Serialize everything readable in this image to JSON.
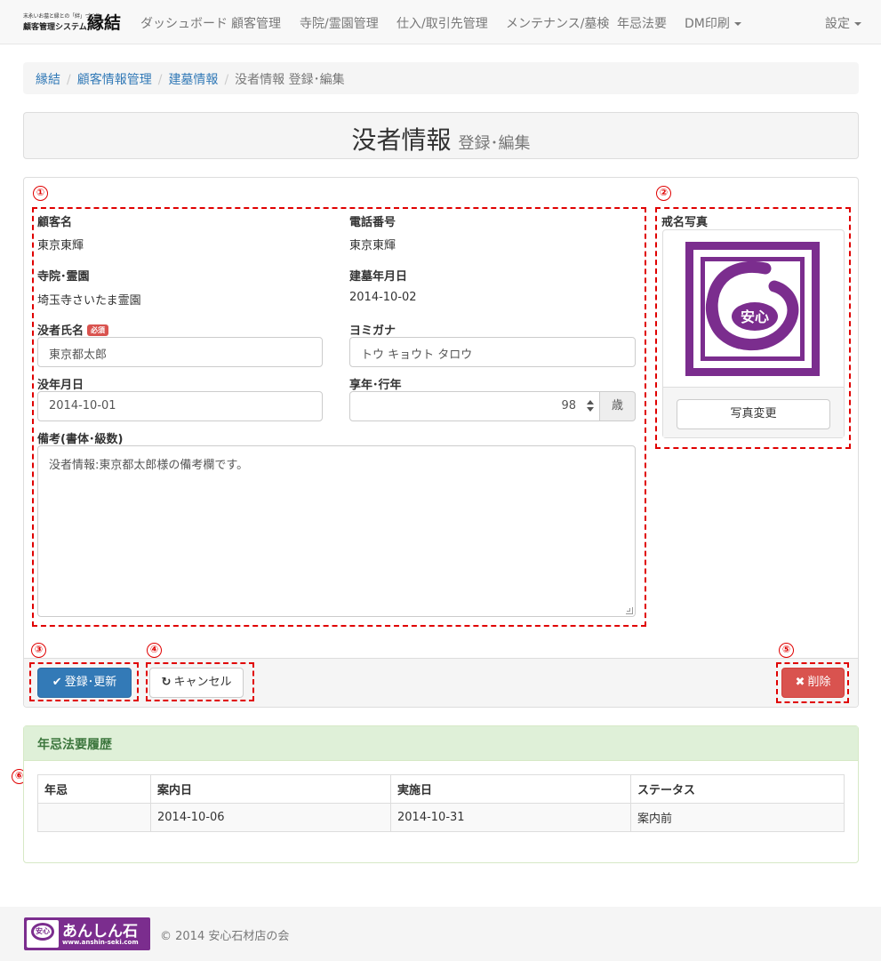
{
  "navbar": {
    "brand_top": "末永いお墓と縁との「絆」づくり",
    "brand_sub": "顧客管理システム",
    "brand_main": "縁結",
    "items": [
      "ダッシュボード",
      "顧客管理",
      "寺院/霊園管理",
      "仕入/取引先管理",
      "メンテナンス/墓検",
      "年忌法要",
      "DM印刷"
    ],
    "settings": "設定"
  },
  "breadcrumb": {
    "items": [
      "縁結",
      "顧客情報管理",
      "建墓情報"
    ],
    "active": "没者情報 登録･編集",
    "separator": "/"
  },
  "page_header": {
    "title": "没者情報",
    "subtitle": "登録･編集"
  },
  "markers": [
    "①",
    "②",
    "③",
    "④",
    "⑤",
    "⑥"
  ],
  "form": {
    "customer_name_label": "顧客名",
    "customer_name": "東京東輝",
    "phone_label": "電話番号",
    "phone": "東京東輝",
    "temple_label": "寺院･霊園",
    "temple": "埼玉寺さいたま霊園",
    "built_date_label": "建墓年月日",
    "built_date": "2014-10-02",
    "deceased_name_label": "没者氏名",
    "required_badge": "必須",
    "deceased_name": "東京都太郎",
    "kana_label": "ヨミガナ",
    "kana": "トウ キョウト タロウ",
    "death_date_label": "没年月日",
    "death_date": "2014-10-01",
    "age_label": "享年･行年",
    "age": "98",
    "age_unit": "歳",
    "notes_label": "備考(書体･級数)",
    "notes": "没者情報:東京都太郎様の備考欄です。"
  },
  "photo": {
    "label": "戒名写真",
    "image_text": "安心",
    "change_button": "写真変更"
  },
  "actions": {
    "submit": "登録･更新",
    "cancel": "キャンセル",
    "delete": "削除"
  },
  "history": {
    "title": "年忌法要履歴",
    "columns": [
      "年忌",
      "案内日",
      "実施日",
      "ステータス"
    ],
    "rows": [
      [
        "",
        "2014-10-06",
        "2014-10-31",
        "案内前"
      ]
    ]
  },
  "footer": {
    "logo_mark": "安心",
    "logo_name": "あんしん石",
    "logo_url": "www.anshin-seki.com",
    "copyright": "© 2014 安心石材店の会"
  },
  "colors": {
    "primary": "#337ab7",
    "danger": "#d9534f",
    "annotation": "#e00000",
    "brand_purple": "#7b2d8e",
    "success_bg": "#dff0d8"
  }
}
